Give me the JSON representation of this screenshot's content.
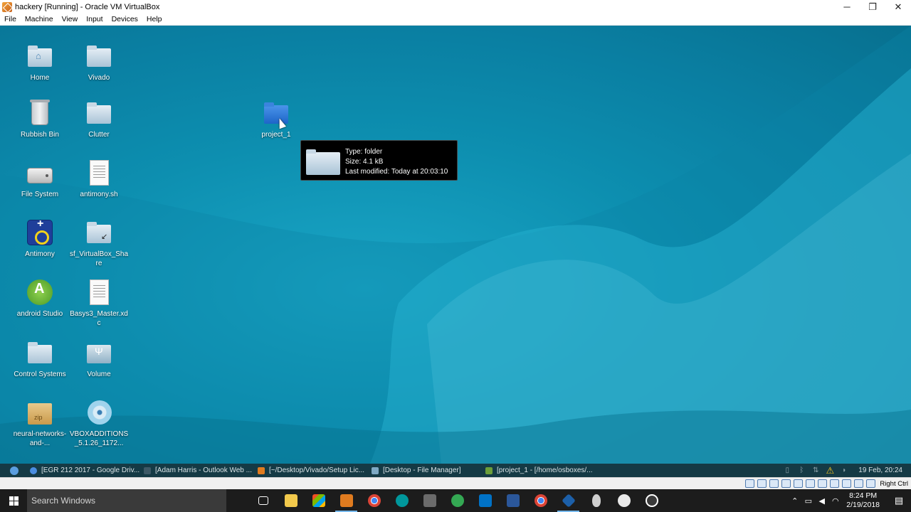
{
  "window": {
    "title": "hackery [Running] - Oracle VM VirtualBox",
    "minimize": "─",
    "restore": "❐",
    "close": "✕"
  },
  "menu": [
    "File",
    "Machine",
    "View",
    "Input",
    "Devices",
    "Help"
  ],
  "desktop_icons": [
    {
      "label": "Home",
      "icon": "home-folder-icon"
    },
    {
      "label": "Vivado",
      "icon": "folder-icon"
    },
    {
      "label": "Rubbish Bin",
      "icon": "trash-icon"
    },
    {
      "label": "Clutter",
      "icon": "folder-icon"
    },
    {
      "label": "File System",
      "icon": "drive-icon"
    },
    {
      "label": "antimony.sh",
      "icon": "script-file-icon"
    },
    {
      "label": "Antimony",
      "icon": "antimony-app-icon"
    },
    {
      "label": "sf_VirtualBox_Share",
      "icon": "shared-folder-icon"
    },
    {
      "label": "android Studio",
      "icon": "android-studio-icon"
    },
    {
      "label": "Basys3_Master.xdc",
      "icon": "text-file-icon"
    },
    {
      "label": "Control Systems",
      "icon": "folder-icon"
    },
    {
      "label": "Volume",
      "icon": "usb-drive-icon"
    },
    {
      "label": "neural-networks-and-...",
      "icon": "archive-icon"
    },
    {
      "label": "VBOXADDITIONS_5.1.26_1172...",
      "icon": "disc-icon"
    },
    {
      "label": "project_1",
      "icon": "folder-icon"
    }
  ],
  "tooltip": {
    "type": "Type: folder",
    "size": "Size: 4.1 kB",
    "modified": "Last modified: Today at 20:03:10"
  },
  "guest_panel": {
    "tasks": [
      {
        "label": "[EGR 212 2017 - Google Driv...",
        "icon": "chrome-icon"
      },
      {
        "label": "[Adam Harris - Outlook Web ...",
        "icon": "browser-tab-icon"
      },
      {
        "label": "[~/Desktop/Vivado/Setup Lic...",
        "icon": "sublime-icon"
      },
      {
        "label": "[Desktop - File Manager]",
        "icon": "file-manager-icon"
      },
      {
        "label": "[project_1 - [/home/osboxes/...",
        "icon": "vivado-icon"
      }
    ],
    "clock": "19 Feb, 20:24"
  },
  "vbox_status": {
    "host_key": "Right Ctrl"
  },
  "win_taskbar": {
    "search_placeholder": "Search Windows",
    "time": "8:24 PM",
    "date": "2/19/2018"
  },
  "colors": {
    "desktop": "#0d8fb0",
    "guest_panel": "#153a45",
    "win_taskbar": "#1c1c1c"
  }
}
